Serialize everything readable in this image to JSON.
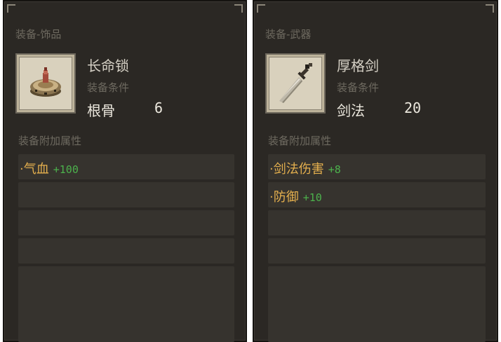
{
  "panels": [
    {
      "category": "装备-饰品",
      "item_name": "长命锁",
      "condition_label": "装备条件",
      "condition_stat": "根骨",
      "condition_value": "6",
      "attr_header": "装备附加属性",
      "attributes": [
        {
          "dot": "·",
          "name": "气血",
          "bonus": "+100"
        }
      ],
      "icon": "longevity-lock-icon"
    },
    {
      "category": "装备-武器",
      "item_name": "厚格剑",
      "condition_label": "装备条件",
      "condition_stat": "剑法",
      "condition_value": "20",
      "attr_header": "装备附加属性",
      "attributes": [
        {
          "dot": "·",
          "name": "剑法伤害",
          "bonus": "+8"
        },
        {
          "dot": "·",
          "name": "防御",
          "bonus": "+10"
        }
      ],
      "icon": "sword-icon"
    }
  ],
  "colors": {
    "panel_bg": "#2b2824",
    "attr_name": "#e5b04e",
    "attr_bonus": "#4cb14c",
    "muted_text": "#6e6a60"
  }
}
